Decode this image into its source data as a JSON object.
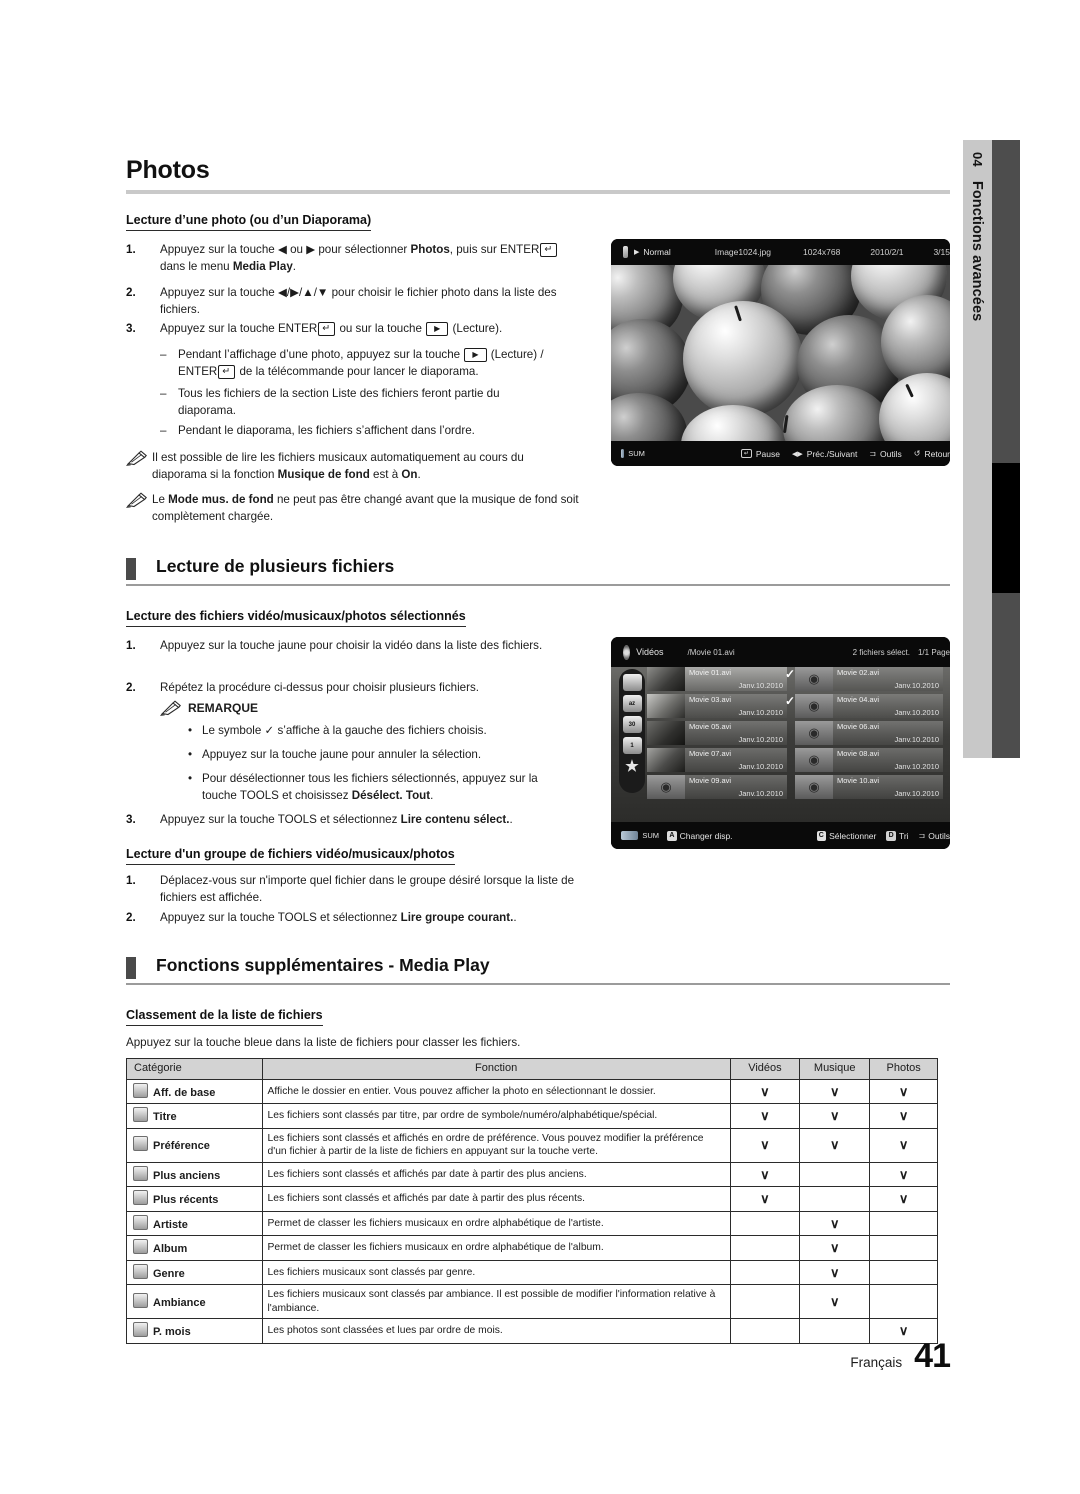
{
  "side_tab": {
    "number": "04",
    "label": "Fonctions avancées"
  },
  "page_title": "Photos",
  "sections": {
    "photos": {
      "h3": "Lecture d’une photo (ou d’un Diaporama)",
      "steps": [
        {
          "n": "1.",
          "html": "Appuyez sur la touche ◀ ou ▶ pour sélectionner <b>Photos</b>, puis sur ENTER<span class=\"key\">↵</span> dans le menu <b>Media Play</b>."
        },
        {
          "n": "2.",
          "html": "Appuyez sur la touche ◀/▶/▲/▼ pour choisir le fichier photo dans la liste des fichiers."
        },
        {
          "n": "3.",
          "html": "Appuyez sur la touche ENTER<span class=\"key\">↵</span> ou sur la touche <span class=\"keyplay\">▶</span> (Lecture)."
        }
      ],
      "dashes": [
        "Pendant l’affichage d’une photo, appuyez sur la touche <span class=\"keyplay\">▶</span> (Lecture) / ENTER<span class=\"key\">↵</span> de la télécommande pour lancer le diaporama.",
        "Tous les fichiers de la section Liste des fichiers feront partie du diaporama.",
        "Pendant le diaporama, les fichiers s’affichent dans l’ordre."
      ],
      "notes": [
        "Il est possible de lire les fichiers musicaux automatiquement au cours du diaporama si la fonction <b>Musique de fond</b> est à <b>On</b>.",
        "Le <b>Mode mus. de fond</b> ne peut pas être changé avant que la musique de fond soit complètement chargée."
      ]
    },
    "plusieurs": {
      "h2": "Lecture de plusieurs fichiers",
      "sub1": {
        "h3": "Lecture des fichiers vidéo/musicaux/photos sélectionnés",
        "steps": [
          {
            "n": "1.",
            "html": "Appuyez sur la touche jaune pour choisir la vidéo dans la liste des fichiers."
          },
          {
            "n": "2.",
            "html": "Répétez la procédure ci-dessus pour choisir plusieurs fichiers."
          }
        ],
        "remarque_label": "REMARQUE",
        "bullets": [
          "Le symbole ✓ s’affiche à la gauche des fichiers choisis.",
          "Appuyez sur la touche jaune pour annuler la sélection.",
          "Pour désélectionner tous les fichiers sélectionnés, appuyez sur la touche TOOLS et choisissez <b>Désélect. Tout</b>."
        ],
        "step3": {
          "n": "3.",
          "html": "Appuyez sur la touche TOOLS et sélectionnez <b>Lire contenu sélect.</b>."
        }
      },
      "sub2": {
        "h3": "Lecture d'un groupe de fichiers vidéo/musicaux/photos",
        "steps": [
          {
            "n": "1.",
            "html": "Déplacez-vous sur n'importe quel fichier dans le groupe désiré lorsque la liste de fichiers est affichée."
          },
          {
            "n": "2.",
            "html": "Appuyez sur la touche TOOLS et sélectionnez <b>Lire groupe courant.</b>."
          }
        ]
      }
    },
    "supplementaires": {
      "h2": "Fonctions supplémentaires - Media Play",
      "h3": "Classement de la liste de fichiers",
      "lead": "Appuyez sur la touche bleue dans la liste de fichiers pour classer les fichiers."
    }
  },
  "photo_screenshot": {
    "mode_icon": "photo-mode-icon",
    "play_arrow": "▶",
    "mode": "Normal",
    "filename": "Image1024.jpg",
    "resolution": "1024x768",
    "date": "2010/2/1",
    "counter": "3/15",
    "footer_left": "SUM",
    "footer_items": [
      {
        "icon": "enter-key-icon",
        "label": "Pause"
      },
      {
        "icon": "left-right-icon",
        "label": "Préc./Suivant"
      },
      {
        "icon": "tools-icon",
        "label": "Outils"
      },
      {
        "icon": "return-icon",
        "label": "Retour"
      }
    ]
  },
  "video_screenshot": {
    "title": "Vidéos",
    "path": "/Movie 01.avi",
    "status": "2 fichiers sélect.",
    "page": "1/1 Page",
    "rail_icons": [
      "folder-icon",
      "title-sort-icon",
      "oldest-icon",
      "newest-icon",
      "favorite-star-icon"
    ],
    "files": [
      {
        "name": "Movie 01.avi",
        "date": "Janv.10.2010",
        "checked": false,
        "selected": true,
        "thumb": "photo"
      },
      {
        "name": "Movie 02.avi",
        "date": "Janv.10.2010",
        "checked": true,
        "selected": false,
        "thumb": "reel"
      },
      {
        "name": "Movie 03.avi",
        "date": "Janv.10.2010",
        "checked": false,
        "selected": false,
        "thumb": "photo"
      },
      {
        "name": "Movie 04.avi",
        "date": "Janv.10.2010",
        "checked": true,
        "selected": false,
        "thumb": "reel"
      },
      {
        "name": "Movie 05.avi",
        "date": "Janv.10.2010",
        "checked": false,
        "selected": false,
        "thumb": "photo"
      },
      {
        "name": "Movie 06.avi",
        "date": "Janv.10.2010",
        "checked": false,
        "selected": false,
        "thumb": "reel"
      },
      {
        "name": "Movie 07.avi",
        "date": "Janv.10.2010",
        "checked": false,
        "selected": false,
        "thumb": "photo"
      },
      {
        "name": "Movie 08.avi",
        "date": "Janv.10.2010",
        "checked": false,
        "selected": false,
        "thumb": "reel"
      },
      {
        "name": "Movie 09.avi",
        "date": "Janv.10.2010",
        "checked": false,
        "selected": false,
        "thumb": "reel"
      },
      {
        "name": "Movie 10.avi",
        "date": "Janv.10.2010",
        "checked": false,
        "selected": false,
        "thumb": "reel"
      }
    ],
    "footer_left": "SUM",
    "footer_a": {
      "key": "A",
      "label": "Changer disp."
    },
    "footer_right": [
      {
        "key": "C",
        "label": "Sélectionner"
      },
      {
        "key": "D",
        "label": "Tri"
      },
      {
        "key": "",
        "label": "Outils",
        "icon": "tools-icon"
      }
    ]
  },
  "table": {
    "headers": [
      "Catégorie",
      "Fonction",
      "Vidéos",
      "Musique",
      "Photos"
    ],
    "rows": [
      {
        "icon": "folder-icon",
        "category": "Aff. de base",
        "fonction": "Affiche le dossier en entier. Vous pouvez afficher la photo en sélectionnant le dossier.",
        "videos": "∨",
        "musique": "∨",
        "photos": "∨"
      },
      {
        "icon": "title-icon",
        "category": "Titre",
        "fonction": "Les fichiers sont classés par titre, par ordre de symbole/numéro/alphabétique/spécial.",
        "videos": "∨",
        "musique": "∨",
        "photos": "∨"
      },
      {
        "icon": "star-icon",
        "category": "Préférence",
        "fonction": "Les fichiers sont classés et affichés en ordre de préférence. Vous pouvez modifier la préférence d'un fichier à partir de la liste de fichiers en appuyant sur la touche verte.",
        "videos": "∨",
        "musique": "∨",
        "photos": "∨"
      },
      {
        "icon": "calendar-30-icon",
        "category": "Plus anciens",
        "fonction": "Les fichiers sont classés et affichés par date à partir des plus anciens.",
        "videos": "∨",
        "musique": "",
        "photos": "∨"
      },
      {
        "icon": "calendar-1-icon",
        "category": "Plus récents",
        "fonction": "Les fichiers sont classés et affichés par date à partir des plus récents.",
        "videos": "∨",
        "musique": "",
        "photos": "∨"
      },
      {
        "icon": "artist-icon",
        "category": "Artiste",
        "fonction": "Permet de classer les fichiers musicaux en ordre alphabétique de l'artiste.",
        "videos": "",
        "musique": "∨",
        "photos": ""
      },
      {
        "icon": "album-icon",
        "category": "Album",
        "fonction": "Permet de classer les fichiers musicaux en ordre alphabétique de l'album.",
        "videos": "",
        "musique": "∨",
        "photos": ""
      },
      {
        "icon": "genre-icon",
        "category": "Genre",
        "fonction": "Les fichiers musicaux sont classés par genre.",
        "videos": "",
        "musique": "∨",
        "photos": ""
      },
      {
        "icon": "mood-icon",
        "category": "Ambiance",
        "fonction": "Les fichiers musicaux sont classés par ambiance. Il est possible de modifier l'information relative à l'ambiance.",
        "videos": "",
        "musique": "∨",
        "photos": ""
      },
      {
        "icon": "month-icon",
        "category": "P. mois",
        "fonction": "Les photos sont classées et lues par ordre de mois.",
        "videos": "",
        "musique": "",
        "photos": "∨"
      }
    ]
  },
  "footer": {
    "language": "Français",
    "page_number": "41"
  }
}
